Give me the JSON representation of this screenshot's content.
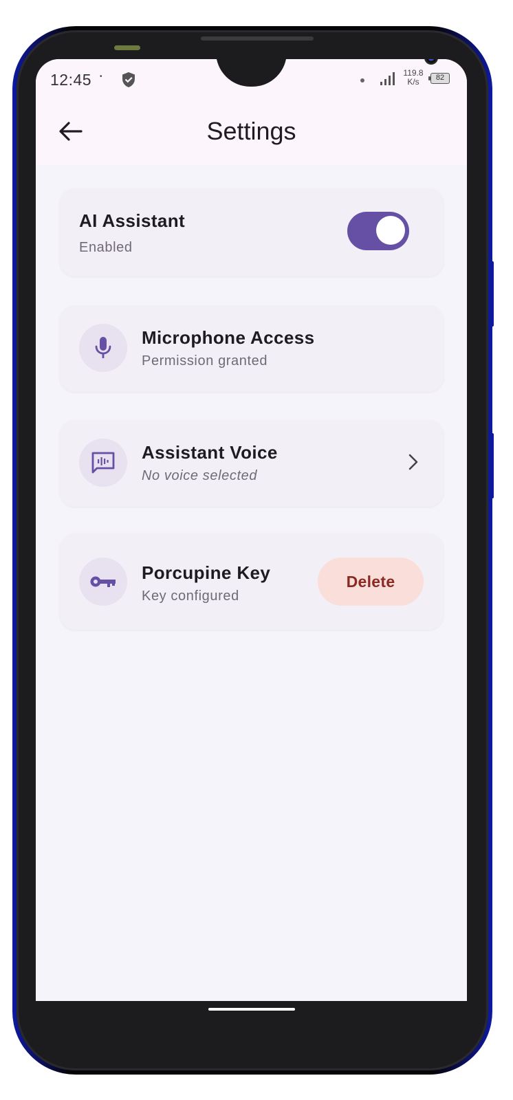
{
  "status_bar": {
    "time": "12:45",
    "small_label": "•",
    "net_speed_value": "119.8",
    "net_speed_unit": "K/s",
    "battery": "82"
  },
  "header": {
    "title": "Settings"
  },
  "settings": {
    "ai_assistant": {
      "title": "AI Assistant",
      "subtitle": "Enabled",
      "enabled": true
    },
    "microphone": {
      "title": "Microphone Access",
      "subtitle": "Permission granted",
      "icon": "mic-icon"
    },
    "voice": {
      "title": "Assistant Voice",
      "subtitle": "No voice selected",
      "icon": "voice-chat-icon"
    },
    "porcupine": {
      "title": "Porcupine Key",
      "subtitle": "Key configured",
      "icon": "key-icon",
      "action_label": "Delete"
    }
  },
  "colors": {
    "accent": "#6550a5",
    "card_background": "#f3eff7",
    "delete_background": "#f9ded9",
    "delete_text": "#8a2a22"
  }
}
